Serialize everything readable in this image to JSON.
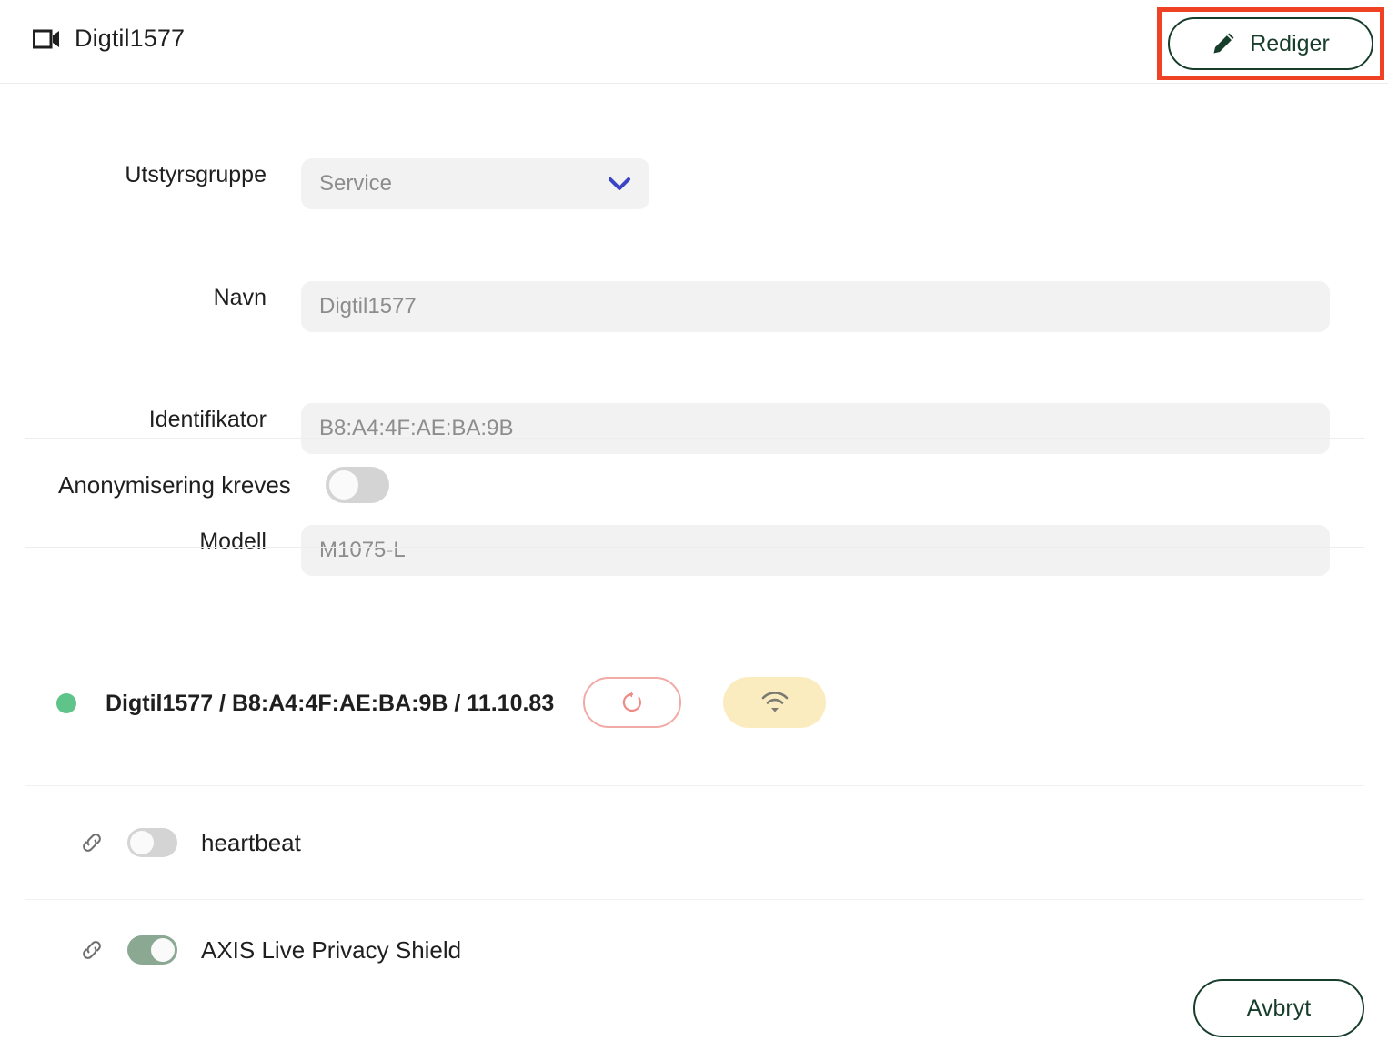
{
  "header": {
    "icon": "video-camera-icon",
    "title": "Digtil1577",
    "edit_button": {
      "label": "Rediger",
      "icon": "pencil-icon",
      "highlight_color": "#ef4123",
      "border_color": "#173d2b"
    }
  },
  "form": {
    "rows": [
      {
        "label": "Utstyrsgruppe",
        "value": "Service",
        "type": "select",
        "icon": "chevron-down-icon"
      },
      {
        "label": "Navn",
        "value": "Digtil1577",
        "type": "text"
      },
      {
        "label": "Identifikator",
        "value": "B8:A4:4F:AE:BA:9B",
        "type": "text"
      },
      {
        "label": "Modell",
        "value": "M1075-L",
        "type": "text"
      }
    ]
  },
  "anonymization": {
    "label": "Anonymisering kreves",
    "enabled": false
  },
  "device": {
    "status_color": "#5fc48a",
    "text": "Digtil1577 / B8:A4:4F:AE:BA:9B / 11.10.83",
    "restart_button": {
      "icon": "restart-icon",
      "border_color": "#f2aaa5"
    },
    "wifi_button": {
      "icon": "wifi-icon",
      "background_color": "#fbecc0"
    }
  },
  "features": [
    {
      "icon": "link-icon",
      "label": "heartbeat",
      "enabled": false
    },
    {
      "icon": "link-icon",
      "label": "AXIS Live Privacy Shield",
      "enabled": true
    }
  ],
  "footer": {
    "cancel_label": "Avbryt"
  }
}
